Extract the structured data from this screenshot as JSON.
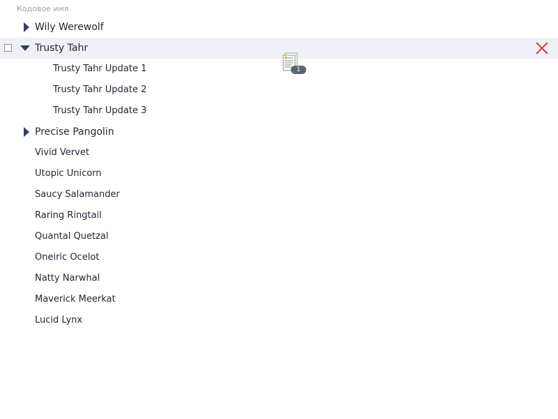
{
  "header": {
    "column_label": "Кодовое имя"
  },
  "tree": {
    "wily": {
      "label": "Wily Werewolf"
    },
    "trusty": {
      "label": "Trusty Tahr",
      "children": [
        "Trusty Tahr Update 1",
        "Trusty Tahr Update 2",
        "Trusty Tahr Update 3"
      ]
    },
    "precise": {
      "label": "Precise Pangolin"
    },
    "flat": [
      "Vivid Vervet",
      "Utopic Unicorn",
      "Saucy Salamander",
      "Raring Ringtail",
      "Quantal Quetzal",
      "Oneiric Ocelot",
      "Natty Narwhal",
      "Maverick Meerkat",
      "Lucid Lynx"
    ]
  },
  "drag": {
    "count": "1"
  },
  "colors": {
    "selected_row": "#eef2f7",
    "caret": "#2c3e6b",
    "delete": "#e53935",
    "header_text": "#9aa3ad"
  },
  "icons": {
    "expand": "caret-right-icon",
    "collapse": "caret-down-icon",
    "delete": "close-x-icon",
    "drag": "document-drag-icon"
  }
}
